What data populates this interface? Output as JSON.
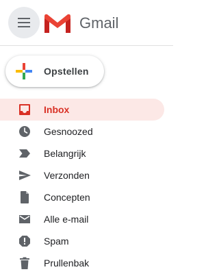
{
  "header": {
    "brand": "Gmail",
    "menu_icon": "hamburger-menu-icon",
    "logo_icon": "gmail-logo-icon"
  },
  "compose": {
    "label": "Opstellen",
    "icon": "colored-plus-icon"
  },
  "nav": {
    "active_index": 0,
    "active_color": "#d93025",
    "active_background": "#fce8e6",
    "items": [
      {
        "label": "Inbox",
        "icon": "inbox-icon"
      },
      {
        "label": "Gesnoozed",
        "icon": "clock-icon"
      },
      {
        "label": "Belangrijk",
        "icon": "important-label-icon"
      },
      {
        "label": "Verzonden",
        "icon": "send-icon"
      },
      {
        "label": "Concepten",
        "icon": "draft-document-icon"
      },
      {
        "label": "Alle e-mail",
        "icon": "mail-icon"
      },
      {
        "label": "Spam",
        "icon": "report-spam-icon"
      },
      {
        "label": "Prullenbak",
        "icon": "trash-icon"
      }
    ]
  },
  "colors": {
    "gmail_red": "#ea4335",
    "google_blue": "#4285f4",
    "google_green": "#34a853",
    "google_yellow": "#fbbc04",
    "icon_grey": "#5f6368"
  }
}
